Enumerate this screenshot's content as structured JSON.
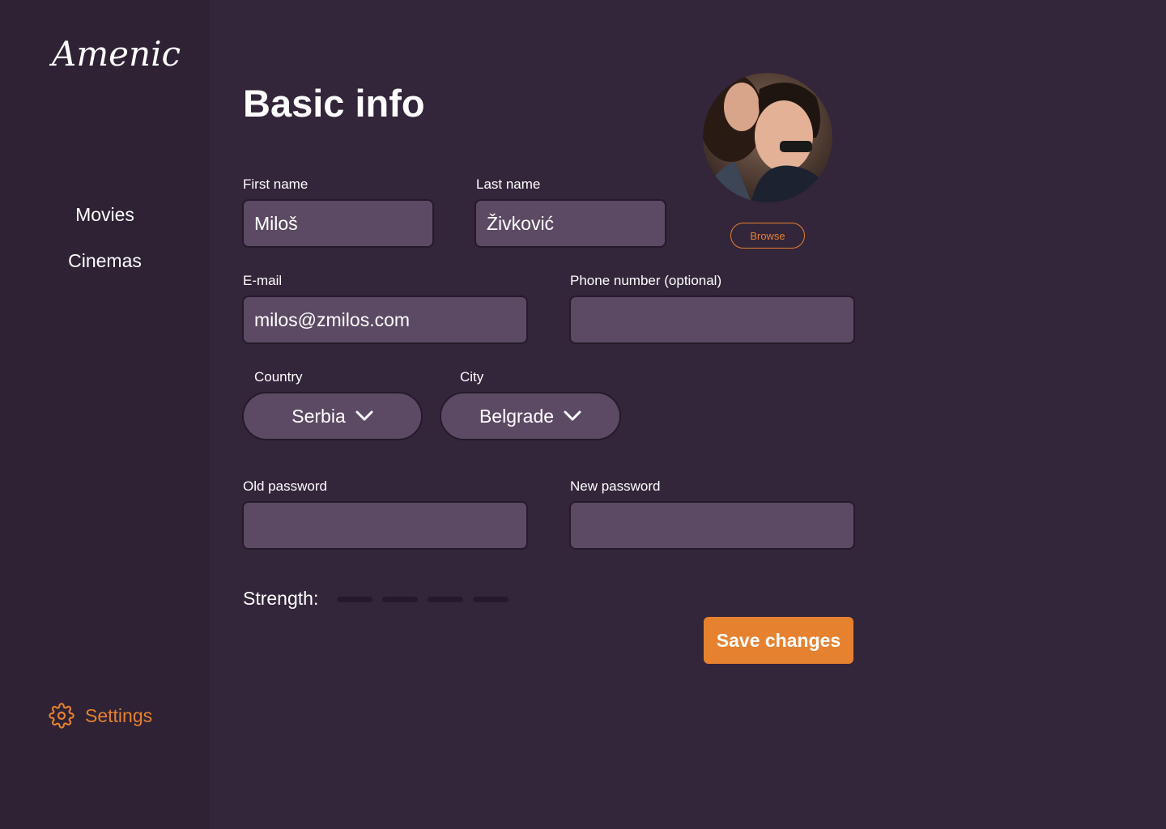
{
  "sidebar": {
    "logo": "Amenic",
    "nav": [
      {
        "label": "Movies"
      },
      {
        "label": "Cinemas"
      }
    ],
    "settings": {
      "label": "Settings",
      "icon": "gear-icon"
    }
  },
  "main": {
    "title": "Basic info",
    "first_name": {
      "label": "First name",
      "value": "Miloš"
    },
    "last_name": {
      "label": "Last name",
      "value": "Živković"
    },
    "email": {
      "label": "E-mail",
      "value": "milos@zmilos.com"
    },
    "phone": {
      "label": "Phone number (optional)",
      "value": ""
    },
    "country": {
      "label": "Country",
      "selected": "Serbia"
    },
    "city": {
      "label": "City",
      "selected": "Belgrade"
    },
    "old_password": {
      "label": "Old password",
      "value": ""
    },
    "new_password": {
      "label": "New password",
      "value": ""
    },
    "strength": {
      "label": "Strength:",
      "level": 0,
      "max": 4
    },
    "browse_label": "Browse",
    "save_label": "Save changes"
  },
  "colors": {
    "background": "#33253a",
    "sidebar": "#2e2234",
    "field": "#5c4a64",
    "accent": "#e6812f"
  }
}
